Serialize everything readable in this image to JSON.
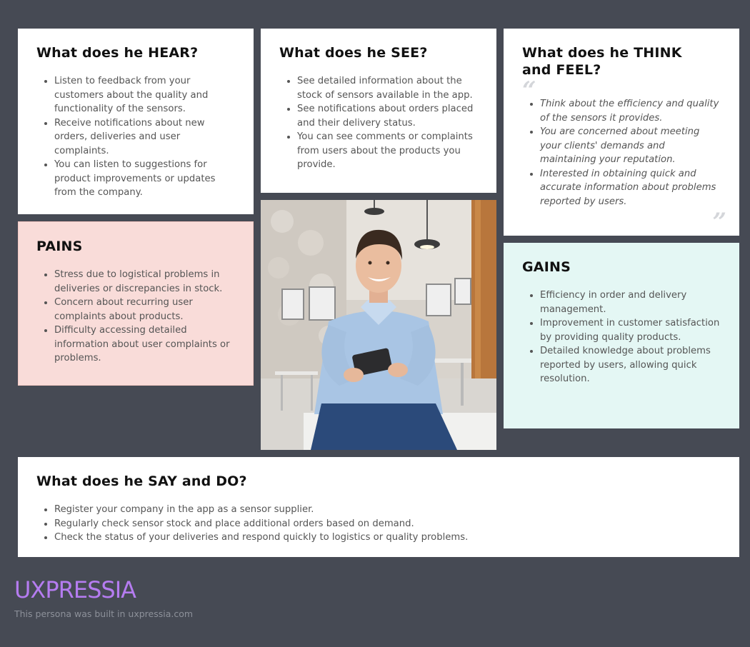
{
  "hear": {
    "title": "What does he HEAR?",
    "items": [
      "Listen to feedback from your customers about the quality and functionality of the sensors.",
      "Receive notifications about new orders, deliveries and user complaints.",
      "You can listen to suggestions for product improvements or updates from the company."
    ]
  },
  "see": {
    "title": "What does he SEE?",
    "items": [
      "See detailed information about the stock of sensors available in the app.",
      "See notifications about orders placed and their delivery status.",
      "You can see comments or complaints from users about the products you provide."
    ]
  },
  "think": {
    "title": "What does he THINK and FEEL?",
    "quote_open": "“",
    "quote_close": "”",
    "items": [
      "Think about the efficiency and quality of the sensors it provides.",
      "You are concerned about meeting your clients' demands and maintaining your reputation.",
      "Interested in obtaining quick and accurate information about problems reported by users."
    ]
  },
  "pains": {
    "title": "PAINS",
    "items": [
      "Stress due to logistical problems in deliveries or discrepancies in stock.",
      "Concern about recurring user complaints about products.",
      "Difficulty accessing detailed information about user complaints or problems."
    ]
  },
  "gains": {
    "title": "GAINS",
    "items": [
      "Efficiency in order and delivery management.",
      "Improvement in customer satisfaction by providing quality products.",
      "Detailed knowledge about problems reported by users, allowing quick resolution."
    ]
  },
  "say": {
    "title": "What does he SAY and DO?",
    "items": [
      "Register your company in the app as a sensor supplier.",
      "Regularly check sensor stock and place additional orders based on demand.",
      "Check the status of your deliveries and respond quickly to logistics or quality problems."
    ]
  },
  "footer": {
    "logo": "UXPRESSIA",
    "note": "This persona was built in uxpressia.com"
  },
  "colors": {
    "background": "#464a54",
    "pains_bg": "#f9dcd9",
    "gains_bg": "#e4f7f4",
    "logo": "#b57cf0"
  }
}
